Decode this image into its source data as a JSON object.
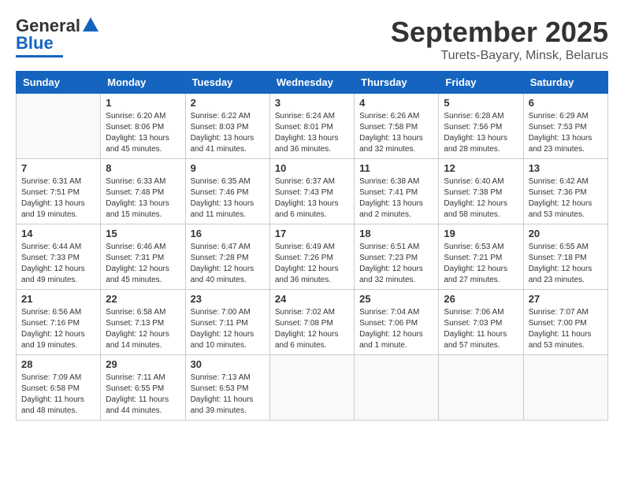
{
  "header": {
    "logo_general": "General",
    "logo_blue": "Blue",
    "month_title": "September 2025",
    "subtitle": "Turets-Bayary, Minsk, Belarus"
  },
  "weekdays": [
    "Sunday",
    "Monday",
    "Tuesday",
    "Wednesday",
    "Thursday",
    "Friday",
    "Saturday"
  ],
  "weeks": [
    [
      {
        "day": "",
        "info": ""
      },
      {
        "day": "1",
        "info": "Sunrise: 6:20 AM\nSunset: 8:06 PM\nDaylight: 13 hours\nand 45 minutes."
      },
      {
        "day": "2",
        "info": "Sunrise: 6:22 AM\nSunset: 8:03 PM\nDaylight: 13 hours\nand 41 minutes."
      },
      {
        "day": "3",
        "info": "Sunrise: 6:24 AM\nSunset: 8:01 PM\nDaylight: 13 hours\nand 36 minutes."
      },
      {
        "day": "4",
        "info": "Sunrise: 6:26 AM\nSunset: 7:58 PM\nDaylight: 13 hours\nand 32 minutes."
      },
      {
        "day": "5",
        "info": "Sunrise: 6:28 AM\nSunset: 7:56 PM\nDaylight: 13 hours\nand 28 minutes."
      },
      {
        "day": "6",
        "info": "Sunrise: 6:29 AM\nSunset: 7:53 PM\nDaylight: 13 hours\nand 23 minutes."
      }
    ],
    [
      {
        "day": "7",
        "info": "Sunrise: 6:31 AM\nSunset: 7:51 PM\nDaylight: 13 hours\nand 19 minutes."
      },
      {
        "day": "8",
        "info": "Sunrise: 6:33 AM\nSunset: 7:48 PM\nDaylight: 13 hours\nand 15 minutes."
      },
      {
        "day": "9",
        "info": "Sunrise: 6:35 AM\nSunset: 7:46 PM\nDaylight: 13 hours\nand 11 minutes."
      },
      {
        "day": "10",
        "info": "Sunrise: 6:37 AM\nSunset: 7:43 PM\nDaylight: 13 hours\nand 6 minutes."
      },
      {
        "day": "11",
        "info": "Sunrise: 6:38 AM\nSunset: 7:41 PM\nDaylight: 13 hours\nand 2 minutes."
      },
      {
        "day": "12",
        "info": "Sunrise: 6:40 AM\nSunset: 7:38 PM\nDaylight: 12 hours\nand 58 minutes."
      },
      {
        "day": "13",
        "info": "Sunrise: 6:42 AM\nSunset: 7:36 PM\nDaylight: 12 hours\nand 53 minutes."
      }
    ],
    [
      {
        "day": "14",
        "info": "Sunrise: 6:44 AM\nSunset: 7:33 PM\nDaylight: 12 hours\nand 49 minutes."
      },
      {
        "day": "15",
        "info": "Sunrise: 6:46 AM\nSunset: 7:31 PM\nDaylight: 12 hours\nand 45 minutes."
      },
      {
        "day": "16",
        "info": "Sunrise: 6:47 AM\nSunset: 7:28 PM\nDaylight: 12 hours\nand 40 minutes."
      },
      {
        "day": "17",
        "info": "Sunrise: 6:49 AM\nSunset: 7:26 PM\nDaylight: 12 hours\nand 36 minutes."
      },
      {
        "day": "18",
        "info": "Sunrise: 6:51 AM\nSunset: 7:23 PM\nDaylight: 12 hours\nand 32 minutes."
      },
      {
        "day": "19",
        "info": "Sunrise: 6:53 AM\nSunset: 7:21 PM\nDaylight: 12 hours\nand 27 minutes."
      },
      {
        "day": "20",
        "info": "Sunrise: 6:55 AM\nSunset: 7:18 PM\nDaylight: 12 hours\nand 23 minutes."
      }
    ],
    [
      {
        "day": "21",
        "info": "Sunrise: 6:56 AM\nSunset: 7:16 PM\nDaylight: 12 hours\nand 19 minutes."
      },
      {
        "day": "22",
        "info": "Sunrise: 6:58 AM\nSunset: 7:13 PM\nDaylight: 12 hours\nand 14 minutes."
      },
      {
        "day": "23",
        "info": "Sunrise: 7:00 AM\nSunset: 7:11 PM\nDaylight: 12 hours\nand 10 minutes."
      },
      {
        "day": "24",
        "info": "Sunrise: 7:02 AM\nSunset: 7:08 PM\nDaylight: 12 hours\nand 6 minutes."
      },
      {
        "day": "25",
        "info": "Sunrise: 7:04 AM\nSunset: 7:06 PM\nDaylight: 12 hours\nand 1 minute."
      },
      {
        "day": "26",
        "info": "Sunrise: 7:06 AM\nSunset: 7:03 PM\nDaylight: 11 hours\nand 57 minutes."
      },
      {
        "day": "27",
        "info": "Sunrise: 7:07 AM\nSunset: 7:00 PM\nDaylight: 11 hours\nand 53 minutes."
      }
    ],
    [
      {
        "day": "28",
        "info": "Sunrise: 7:09 AM\nSunset: 6:58 PM\nDaylight: 11 hours\nand 48 minutes."
      },
      {
        "day": "29",
        "info": "Sunrise: 7:11 AM\nSunset: 6:55 PM\nDaylight: 11 hours\nand 44 minutes."
      },
      {
        "day": "30",
        "info": "Sunrise: 7:13 AM\nSunset: 6:53 PM\nDaylight: 11 hours\nand 39 minutes."
      },
      {
        "day": "",
        "info": ""
      },
      {
        "day": "",
        "info": ""
      },
      {
        "day": "",
        "info": ""
      },
      {
        "day": "",
        "info": ""
      }
    ]
  ]
}
